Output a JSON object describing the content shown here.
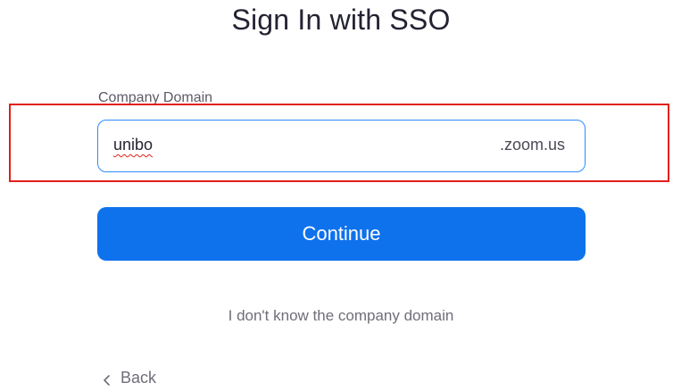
{
  "header": {
    "title": "Sign In with SSO"
  },
  "form": {
    "label": "Company Domain",
    "domain_value": "unibo",
    "domain_suffix": ".zoom.us",
    "continue_label": "Continue",
    "forgot_label": "I don't know the company domain",
    "back_label": "Back"
  },
  "icons": {
    "back": "chevron-left-icon"
  },
  "colors": {
    "accent": "#0e72ed",
    "input_border": "#2d8cff",
    "highlight": "#e0201a"
  }
}
